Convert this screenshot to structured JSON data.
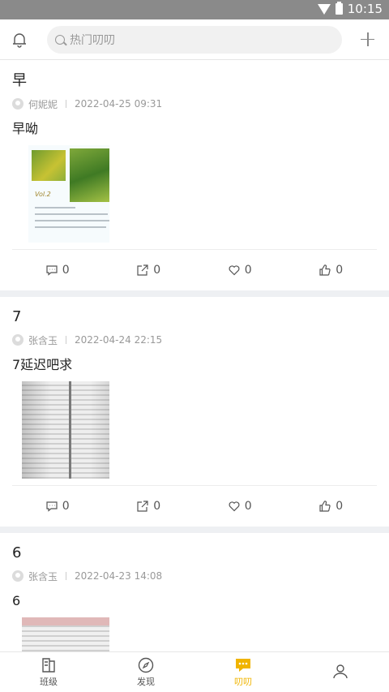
{
  "status_bar": {
    "time": "10:15"
  },
  "topbar": {
    "search_placeholder": "热门叨叨"
  },
  "posts": [
    {
      "title": "早",
      "author": "何妮妮",
      "date": "2022-04-25 09:31",
      "body": "早呦",
      "comments": "0",
      "shares": "0",
      "likes": "0",
      "thumbs": "0"
    },
    {
      "title": "7",
      "author": "张含玉",
      "date": "2022-04-24 22:15",
      "body": "7延迟吧求",
      "comments": "0",
      "shares": "0",
      "likes": "0",
      "thumbs": "0"
    },
    {
      "title": "6",
      "author": "张含玉",
      "date": "2022-04-23 14:08",
      "body": "6"
    }
  ],
  "image1_text": {
    "vol": "Vol.2"
  },
  "tabs": [
    {
      "label": "班级"
    },
    {
      "label": "发现"
    },
    {
      "label": "叨叨"
    },
    {
      "label": ""
    }
  ],
  "colors": {
    "accent": "#f0b400",
    "status_bar": "#8a8a8a"
  }
}
